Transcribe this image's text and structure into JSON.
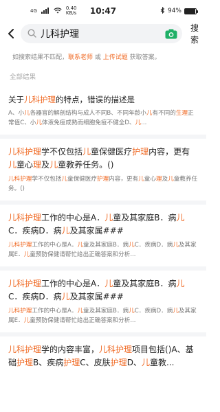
{
  "status": {
    "network": "4G",
    "speed": "0.40",
    "speed_unit": "KB/s",
    "time": "10:47",
    "battery": "94%",
    "battery_level": 0.94
  },
  "search": {
    "query": "儿科护理",
    "button": "搜索"
  },
  "hint": {
    "prefix": "如搜索结果不匹配，",
    "contact": "联系老师",
    "or": " 或 ",
    "upload": "上传试题",
    "suffix": " 获取答案。"
  },
  "section": {
    "title": "全部结果"
  },
  "results": [
    {
      "title": [
        "关于",
        "儿科护理",
        "的特点，错误的描述是"
      ],
      "body": [
        "A、小",
        "儿",
        "各器官的解剖结构与成人不同B、不同年龄小",
        "儿",
        "有不同的",
        "生理",
        "正常值C、小",
        "儿",
        "体液免疫成熟而细胞免疫不健全D、",
        "儿",
        "..."
      ]
    },
    {
      "title": [
        "儿科护理",
        "学不仅包括",
        "儿",
        "童保健医疗",
        "护理",
        "内容，更有",
        "儿",
        "童心",
        "理",
        "及",
        "儿",
        "童教养任务。()"
      ],
      "body": [
        "儿科护理",
        "学不仅包括",
        "儿",
        "童保健医疗",
        "护理",
        "内容，更有",
        "儿",
        "童心",
        "理",
        "及",
        "儿",
        "童教养任务。()"
      ]
    },
    {
      "title": [
        "儿科护理",
        "工作的中心是A．",
        "儿",
        "童及其家庭B．病",
        "儿",
        "C．疾病D．病",
        "儿",
        "及其家属###"
      ],
      "body": [
        "儿科护理",
        "工作的中心是A．",
        "儿",
        "童及其家庭B．病",
        "儿",
        "C．疾病D．病",
        "儿",
        "及其家属E．",
        "儿",
        "童预防保健请帮忙给出正确答案和分析..."
      ]
    },
    {
      "title": [
        "儿科护理",
        "工作的中心是A．",
        "儿",
        "童及其家庭B．病",
        "儿",
        "C．疾病D．病",
        "儿",
        "及其家属###"
      ],
      "body": [
        "儿科护理",
        "工作的中心是A．",
        "儿",
        "童及其家庭B．病",
        "儿",
        "C．疾病D．病",
        "儿",
        "及其家属E．",
        "儿",
        "童预防保健请帮忙给出正确答案和分析..."
      ]
    },
    {
      "title": [
        "儿科护理",
        "学的内容丰富，",
        "儿科护理",
        "项目包括()A、基础",
        "护理",
        "B、疾病",
        "护理",
        "C、皮肤",
        "护理",
        "D、",
        "儿",
        "童教..."
      ],
      "body": []
    }
  ],
  "colors": {
    "accent": "#f06a24",
    "camera": "#1fb067"
  }
}
